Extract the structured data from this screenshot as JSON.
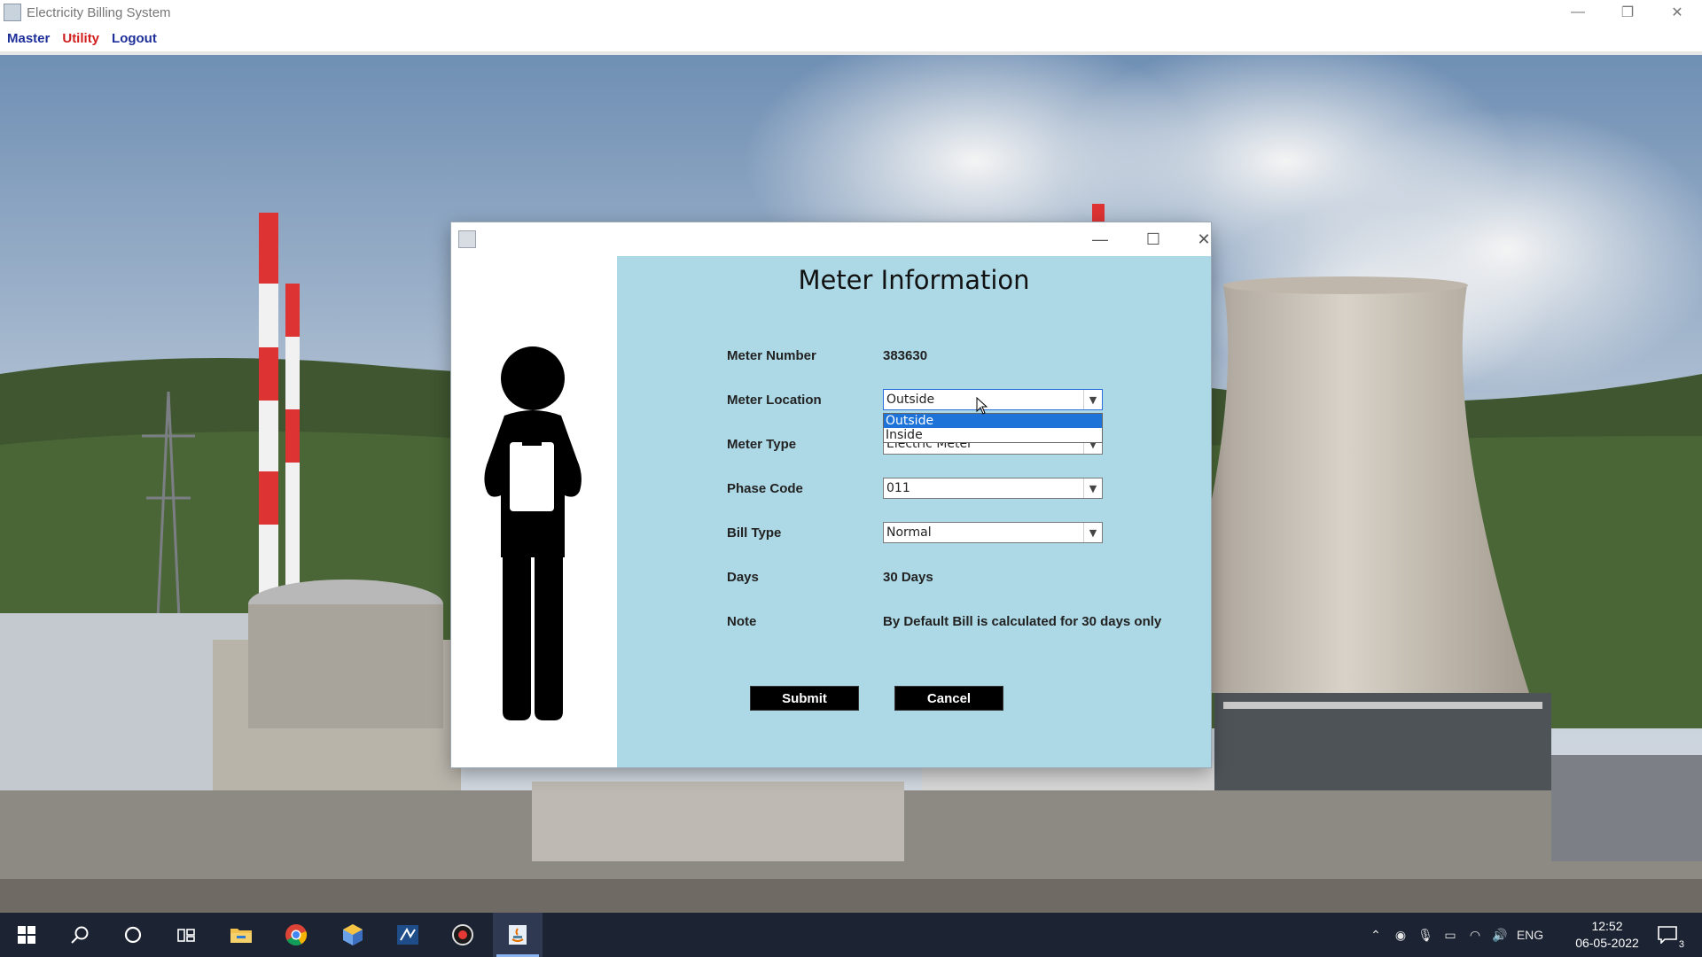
{
  "app": {
    "title": "Electricity Billing System",
    "menu": {
      "master": "Master",
      "utility": "Utility",
      "logout": "Logout"
    },
    "window_controls": {
      "minimize": "—",
      "maximize": "❐",
      "close": "✕"
    }
  },
  "dialog": {
    "window_controls": {
      "minimize": "—",
      "maximize": "☐",
      "close": "✕"
    },
    "heading": "Meter Information",
    "fields": {
      "meter_number": {
        "label": "Meter Number",
        "value": "383630"
      },
      "meter_location": {
        "label": "Meter Location",
        "value": "Outside",
        "options": [
          "Outside",
          "Inside"
        ],
        "open": true
      },
      "meter_type": {
        "label": "Meter Type",
        "value": "Electric Meter"
      },
      "phase_code": {
        "label": "Phase Code",
        "value": "011"
      },
      "bill_type": {
        "label": "Bill Type",
        "value": "Normal"
      },
      "days": {
        "label": "Days",
        "value": "30 Days"
      },
      "note": {
        "label": "Note",
        "value": "By Default Bill is calculated for 30 days only"
      }
    },
    "buttons": {
      "submit": "Submit",
      "cancel": "Cancel"
    }
  },
  "taskbar": {
    "icons": [
      "windows-start-icon",
      "search-icon",
      "cortana-icon",
      "task-view-icon",
      "file-explorer-icon",
      "chrome-icon",
      "app-hexagon-icon",
      "ide-icon",
      "record-icon",
      "java-app-icon"
    ],
    "tray": {
      "language": "ENG",
      "notifications_count": "3"
    },
    "clock": {
      "time": "12:52",
      "date": "06-05-2022"
    }
  },
  "colors": {
    "panel_bg": "#add8e6",
    "button_bg": "#000000",
    "selection": "#1e73d8",
    "menu_blue": "#1f2f9a",
    "menu_red": "#d11e1e"
  }
}
